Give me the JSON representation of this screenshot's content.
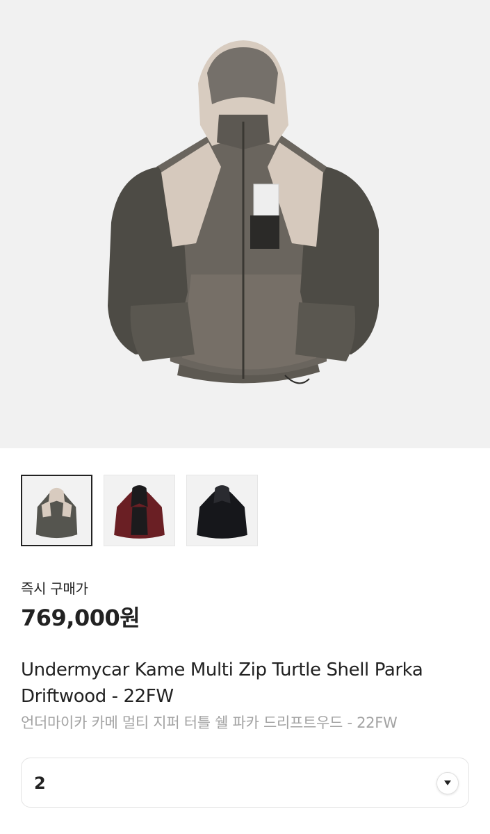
{
  "product": {
    "price_label": "즉시 구매가",
    "price": "769,000원",
    "title": "Undermycar Kame Multi Zip Turtle Shell Parka Driftwood - 22FW",
    "subtitle": "언더마이카 카메 멀티 지퍼 터틀 쉘 파카 드리프트우드 - 22FW"
  },
  "gallery": {
    "hero_image": "jacket-driftwood-photo",
    "thumbnails": [
      {
        "name": "driftwood",
        "colors": [
          "#55554f",
          "#d8cbbf"
        ]
      },
      {
        "name": "burgundy",
        "colors": [
          "#6a1f24",
          "#1c1b1d"
        ]
      },
      {
        "name": "black",
        "colors": [
          "#16171b",
          "#2a2b30"
        ]
      }
    ],
    "selected_index": 0
  },
  "size_select": {
    "value": "2",
    "icon": "chevron-down-icon"
  }
}
